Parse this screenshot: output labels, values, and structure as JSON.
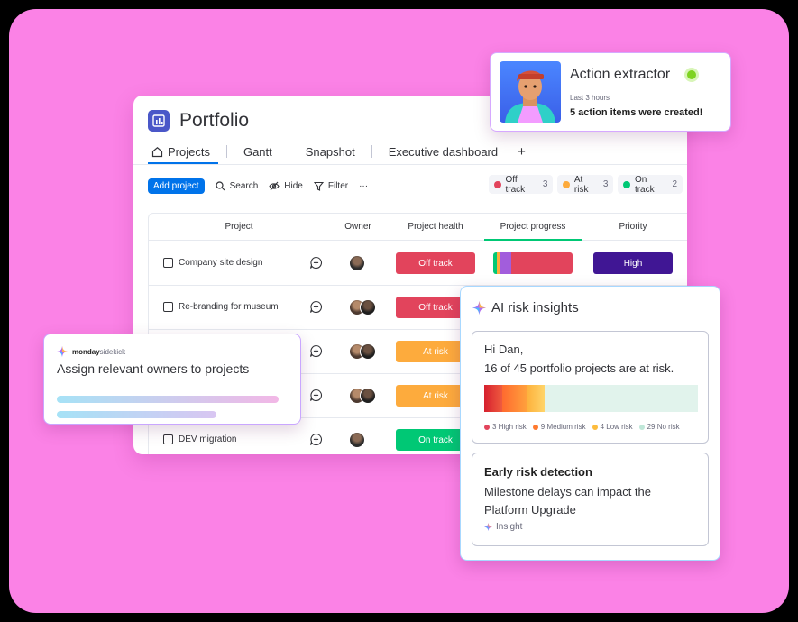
{
  "board": {
    "title": "Portfolio",
    "tabs": [
      "Projects",
      "Gantt",
      "Snapshot",
      "Executive dashboard",
      "+"
    ],
    "toolbar": {
      "add_label": "Add project",
      "search": "Search",
      "hide": "Hide",
      "filter": "Filter",
      "more": "···"
    },
    "status_pills": [
      {
        "label": "Off track",
        "count": "3",
        "color": "#e2445c"
      },
      {
        "label": "At risk",
        "count": "3",
        "color": "#fdab3d"
      },
      {
        "label": "On track",
        "count": "2",
        "color": "#00c875"
      }
    ],
    "columns": [
      "Project",
      "Owner",
      "Project health",
      "Project progress",
      "Priority"
    ],
    "rows": [
      {
        "name": "Company site design",
        "health": "Off track",
        "health_color": "#e2445c",
        "priority": "High"
      },
      {
        "name": "Re-branding for museum",
        "health": "Off track",
        "health_color": "#e2445c",
        "priority": ""
      },
      {
        "name": "",
        "health": "At risk",
        "health_color": "#fdab3d",
        "priority": ""
      },
      {
        "name": "",
        "health": "At risk",
        "health_color": "#fdab3d",
        "priority": ""
      },
      {
        "name": "DEV migration",
        "health": "On track",
        "health_color": "#00c875",
        "priority": ""
      }
    ]
  },
  "action": {
    "title": "Action extractor",
    "subtitle": "Last 3 hours",
    "text": "5 action items were created!"
  },
  "sidekick": {
    "brand_bold": "monday",
    "brand_light": "sidekick",
    "text": "Assign relevant owners to projects"
  },
  "ai": {
    "title": "AI risk insights",
    "greeting": "Hi Dan,",
    "message": "16 of 45 portfolio projects are at risk.",
    "legend": [
      {
        "label": "3 High risk",
        "color": "#e2445c",
        "value": 3
      },
      {
        "label": "9 Medium risk",
        "color": "#ff7a2f",
        "value": 9
      },
      {
        "label": "4 Low risk",
        "color": "#fdbc3d",
        "value": 4
      },
      {
        "label": "29 No risk",
        "color": "#bfe7d8",
        "value": 29
      }
    ],
    "early_title": "Early risk detection",
    "early_text": "Milestone delays can impact the Platform Upgrade",
    "tag": "Insight"
  }
}
